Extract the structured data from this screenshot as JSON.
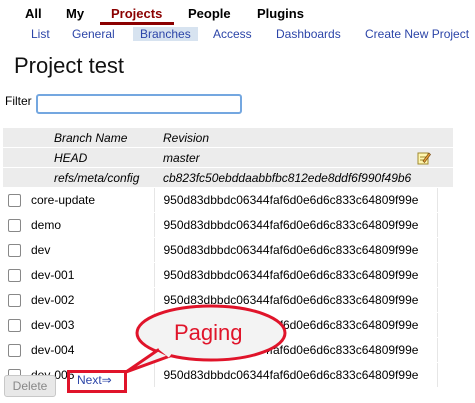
{
  "top_tabs": [
    "All",
    "My",
    "Projects",
    "People",
    "Plugins"
  ],
  "sub_tabs": [
    "List",
    "General",
    "Branches",
    "Access",
    "Dashboards",
    "Create New Project"
  ],
  "page_title": "Project test",
  "filter": {
    "label": "Filter",
    "value": ""
  },
  "table": {
    "headers": [
      "Branch Name",
      "Revision"
    ],
    "special_rows": [
      {
        "name": "HEAD",
        "revision": "master"
      },
      {
        "name": "refs/meta/config",
        "revision": "cb823fc50ebddaabbfbc812ede8ddf6f990f49b6"
      }
    ],
    "rows": [
      {
        "name": "core-update",
        "revision": "950d83dbbdc06344faf6d0e6d6c833c64809f99e"
      },
      {
        "name": "demo",
        "revision": "950d83dbbdc06344faf6d0e6d6c833c64809f99e"
      },
      {
        "name": "dev",
        "revision": "950d83dbbdc06344faf6d0e6d6c833c64809f99e"
      },
      {
        "name": "dev-001",
        "revision": "950d83dbbdc06344faf6d0e6d6c833c64809f99e"
      },
      {
        "name": "dev-002",
        "revision": "950d83dbbdc06344faf6d0e6d6c833c64809f99e"
      },
      {
        "name": "dev-003",
        "revision": "950d83dbbdc06344faf6d0e6d6c833c64809f99e"
      },
      {
        "name": "dev-004",
        "revision": "950d83dbbdc06344faf6d0e6d6c833c64809f99e"
      },
      {
        "name": "dev-005",
        "revision": "950d83dbbdc06344faf6d0e6d6c833c64809f99e"
      }
    ]
  },
  "delete_label": "Delete",
  "next_label": "Next⇒",
  "callout_label": "Paging",
  "colors": {
    "active_tab": "#8b0000",
    "link": "#2c45a8",
    "callout": "#e0142a"
  }
}
